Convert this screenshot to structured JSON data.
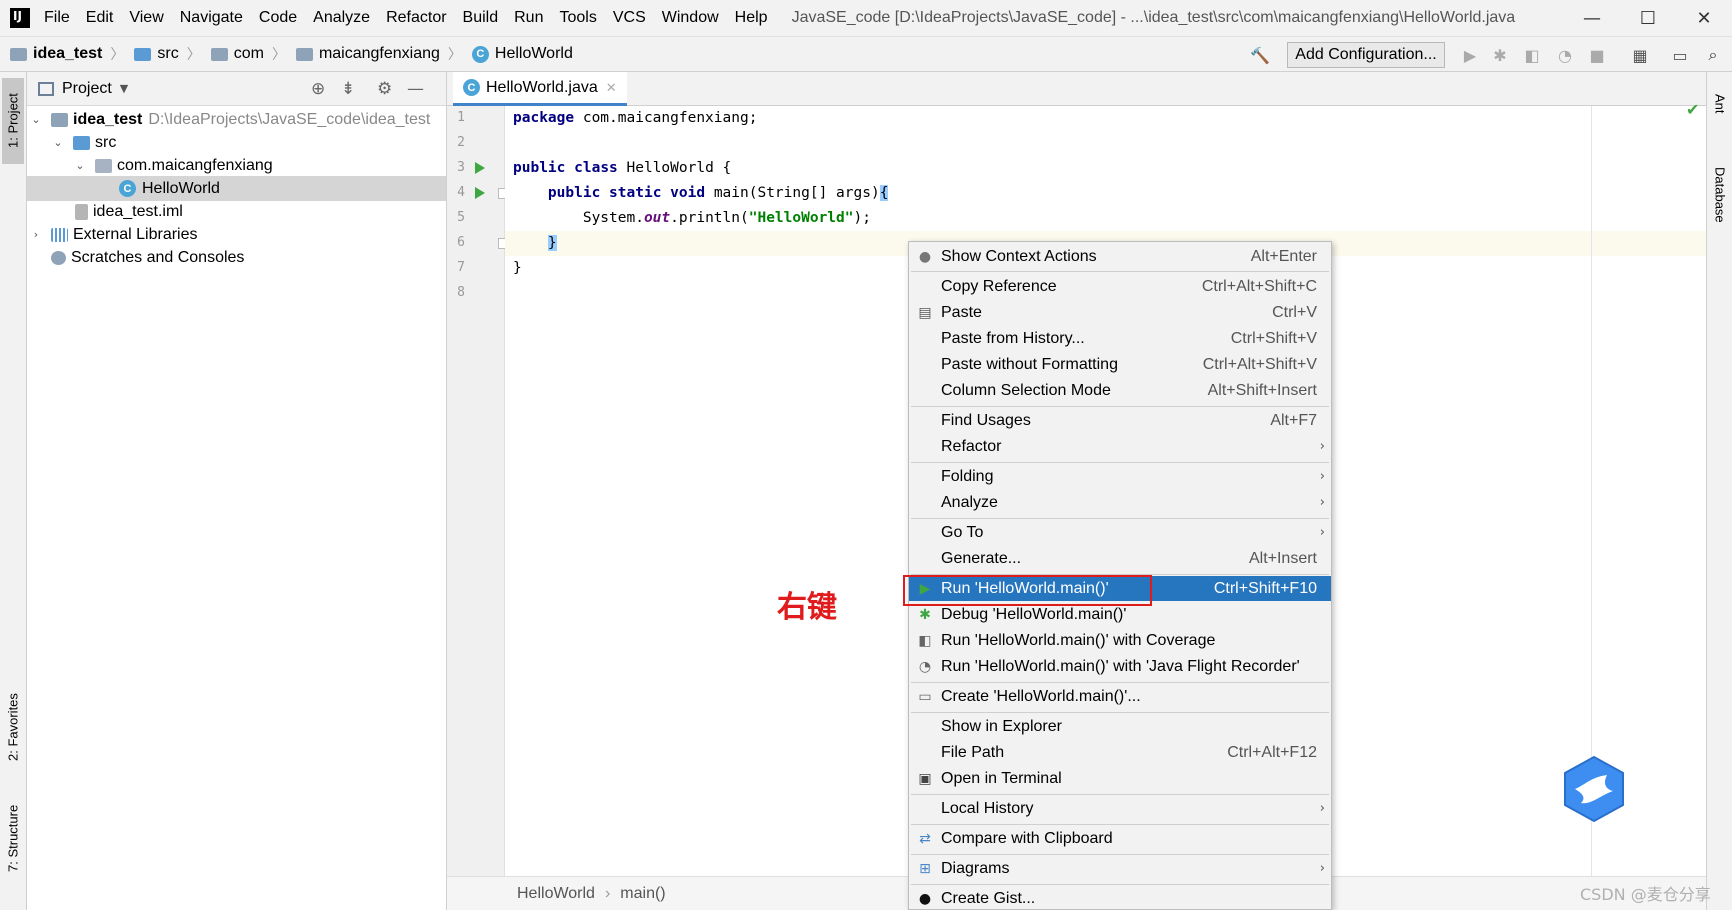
{
  "menubar": {
    "items": [
      "File",
      "Edit",
      "View",
      "Navigate",
      "Code",
      "Analyze",
      "Refactor",
      "Build",
      "Run",
      "Tools",
      "VCS",
      "Window",
      "Help"
    ],
    "window_title": "JavaSE_code [D:\\IdeaProjects\\JavaSE_code] - ...\\idea_test\\src\\com\\maicangfenxiang\\HelloWorld.java"
  },
  "navbar": {
    "crumbs": [
      "idea_test",
      "src",
      "com",
      "maicangfenxiang",
      "HelloWorld"
    ],
    "add_config_label": "Add Configuration..."
  },
  "left_stripe": {
    "project_tab": "1: Project",
    "favorites_tab": "2: Favorites",
    "structure_tab": "7: Structure"
  },
  "right_stripe": {
    "ant_tab": "Ant",
    "database_tab": "Database"
  },
  "project_panel": {
    "title": "Project",
    "tree": [
      {
        "label": "idea_test",
        "path": "D:\\IdeaProjects\\JavaSE_code\\idea_test"
      },
      {
        "label": "src"
      },
      {
        "label": "com.maicangfenxiang"
      },
      {
        "label": "HelloWorld"
      },
      {
        "label": "idea_test.iml"
      },
      {
        "label": "External Libraries"
      },
      {
        "label": "Scratches and Consoles"
      }
    ]
  },
  "editor": {
    "tab_label": "HelloWorld.java",
    "line_numbers": [
      "1",
      "2",
      "3",
      "4",
      "5",
      "6",
      "7",
      "8"
    ],
    "code": {
      "l1_kw": "package",
      "l1_rest": " com.maicangfenxiang;",
      "l3_kw1": "public",
      "l3_kw2": "class",
      "l3_rest": " HelloWorld {",
      "l4_kw1": "public",
      "l4_kw2": "static",
      "l4_kw3": "void",
      "l4_rest": " main(String[] args)",
      "l4_brace": "{",
      "l5_a": "System.",
      "l5_field": "out",
      "l5_b": ".println(",
      "l5_str": "\"HelloWorld\"",
      "l5_c": ");",
      "l6_brace": "}",
      "l7": "}"
    },
    "breadcrumbs": [
      "HelloWorld",
      "main()"
    ]
  },
  "context_menu": {
    "items": [
      {
        "label": "Show Context Actions",
        "shortcut": "Alt+Enter"
      },
      {
        "label": "Copy Reference",
        "shortcut": "Ctrl+Alt+Shift+C"
      },
      {
        "label": "Paste",
        "shortcut": "Ctrl+V"
      },
      {
        "label": "Paste from History...",
        "shortcut": "Ctrl+Shift+V"
      },
      {
        "label": "Paste without Formatting",
        "shortcut": "Ctrl+Alt+Shift+V"
      },
      {
        "label": "Column Selection Mode",
        "shortcut": "Alt+Shift+Insert"
      },
      {
        "label": "Find Usages",
        "shortcut": "Alt+F7"
      },
      {
        "label": "Refactor"
      },
      {
        "label": "Folding"
      },
      {
        "label": "Analyze"
      },
      {
        "label": "Go To"
      },
      {
        "label": "Generate...",
        "shortcut": "Alt+Insert"
      },
      {
        "label": "Run 'HelloWorld.main()'",
        "shortcut": "Ctrl+Shift+F10"
      },
      {
        "label": "Debug 'HelloWorld.main()'"
      },
      {
        "label": "Run 'HelloWorld.main()' with Coverage"
      },
      {
        "label": "Run 'HelloWorld.main()' with 'Java Flight Recorder'"
      },
      {
        "label": "Create 'HelloWorld.main()'..."
      },
      {
        "label": "Show in Explorer"
      },
      {
        "label": "File Path",
        "shortcut": "Ctrl+Alt+F12"
      },
      {
        "label": "Open in Terminal"
      },
      {
        "label": "Local History"
      },
      {
        "label": "Compare with Clipboard"
      },
      {
        "label": "Diagrams"
      },
      {
        "label": "Create Gist..."
      }
    ]
  },
  "annotation": "右键",
  "watermark": "CSDN @麦仓分享",
  "colors": {
    "highlight": "#2675bf",
    "annotation_red": "#e01b1b",
    "run_green": "#3fa641"
  }
}
